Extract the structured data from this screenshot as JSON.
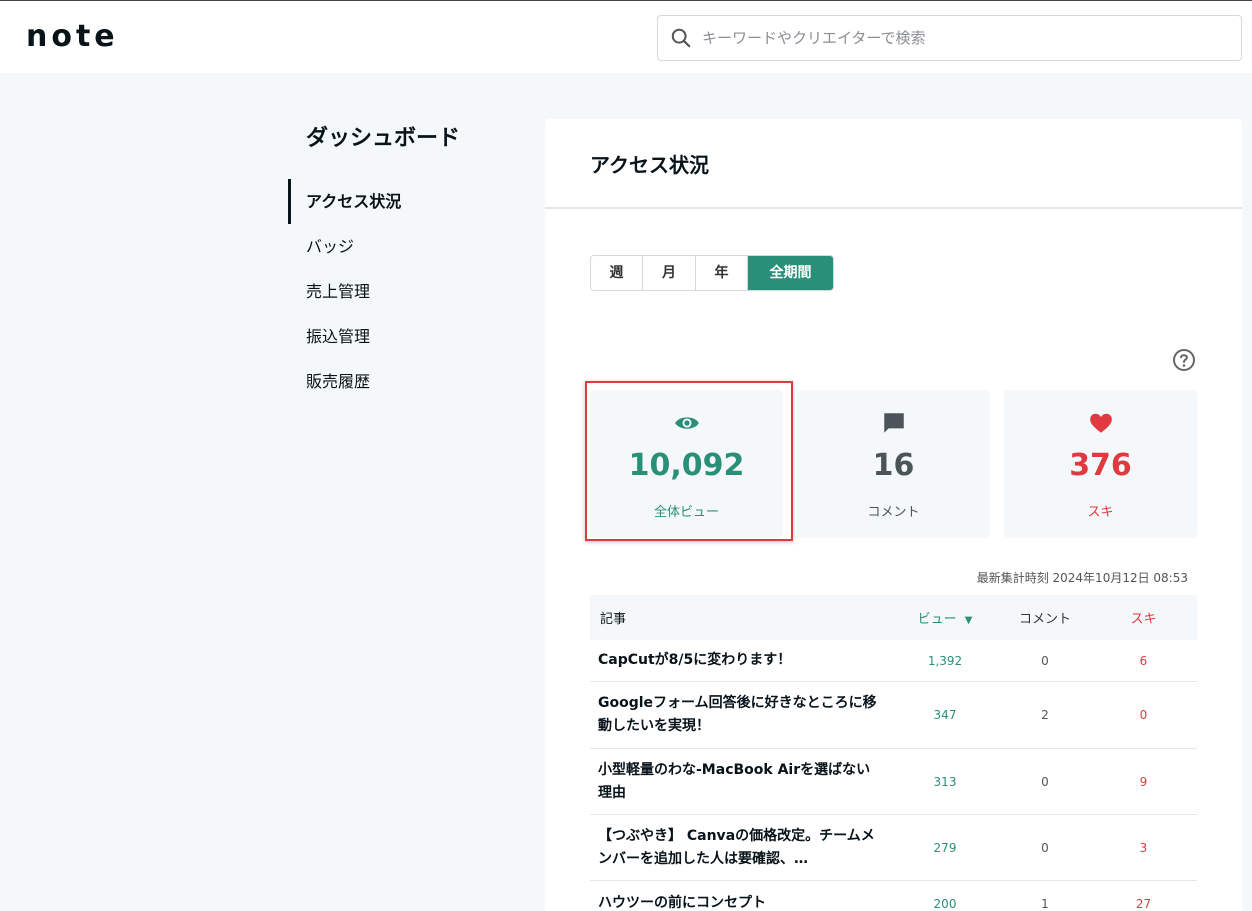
{
  "header": {
    "logo": "note",
    "search_placeholder": "キーワードやクリエイターで検索"
  },
  "sidebar": {
    "title": "ダッシュボード",
    "items": [
      {
        "label": "アクセス状況",
        "active": true
      },
      {
        "label": "バッジ"
      },
      {
        "label": "売上管理"
      },
      {
        "label": "振込管理"
      },
      {
        "label": "販売履歴"
      }
    ]
  },
  "main": {
    "title": "アクセス状況",
    "periods": [
      "週",
      "月",
      "年",
      "全期間"
    ],
    "active_period": "全期間",
    "stats": [
      {
        "icon": "eye-icon",
        "value": "10,092",
        "label": "全体ビュー",
        "color": "#2a8f78"
      },
      {
        "icon": "comment-icon",
        "value": "16",
        "label": "コメント",
        "color": "#4a5459"
      },
      {
        "icon": "heart-icon",
        "value": "376",
        "label": "スキ",
        "color": "#e0393f"
      }
    ],
    "updated": "最新集計時刻 2024年10月12日 08:53",
    "table": {
      "headers": {
        "article": "記事",
        "views": "ビュー",
        "comments": "コメント",
        "likes": "スキ"
      },
      "rows": [
        {
          "title": "CapCutが8/5に変わります！",
          "views": "1,392",
          "comments": "0",
          "likes": "6"
        },
        {
          "title": "Googleフォーム回答後に好きなところに移動したいを実現！",
          "views": "347",
          "comments": "2",
          "likes": "0"
        },
        {
          "title": "小型軽量のわな-MacBook Airを選ばない理由",
          "views": "313",
          "comments": "0",
          "likes": "9"
        },
        {
          "title": "【つぶやき】 Canvaの価格改定。チームメンバーを追加した人は要確認、…",
          "views": "279",
          "comments": "0",
          "likes": "3"
        },
        {
          "title": "ハウツーの前にコンセプト",
          "views": "200",
          "comments": "1",
          "likes": "27"
        }
      ]
    }
  },
  "colors": {
    "accent": "#2a8f78",
    "like": "#e0393f",
    "highlight": "#e0393f"
  }
}
